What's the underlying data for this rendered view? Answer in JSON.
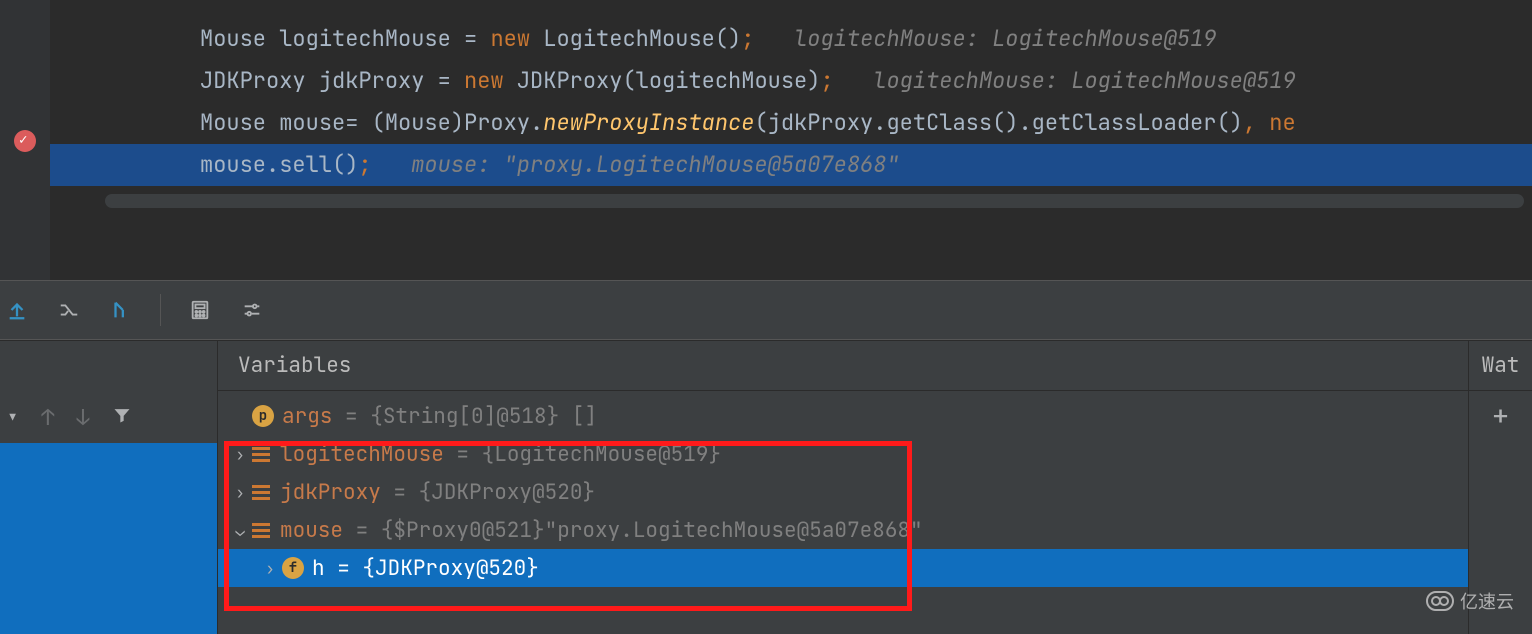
{
  "editor": {
    "lines": [
      {
        "indent": "",
        "type1": "Mouse",
        "id1": "logitechMouse",
        "eq": " = ",
        "kw": "new",
        "call": " LogitechMouse()",
        "semi": ";",
        "hint": "logitechMouse: LogitechMouse@519"
      },
      {
        "indent": "",
        "type1": "JDKProxy",
        "id1": "jdkProxy",
        "eq": " = ",
        "kw": "new",
        "call": " JDKProxy(logitechMouse)",
        "semi": ";",
        "hint": "logitechMouse: LogitechMouse@519"
      },
      {
        "indent": "",
        "type1": "Mouse",
        "id1": "mouse",
        "eq": "= (Mouse)Proxy.",
        "mtd": "newProxyInstance",
        "rest": "(jdkProxy.getClass().getClassLoader()",
        "tail": ", ne"
      },
      {
        "current": true,
        "call": "mouse.sell()",
        "semi": ";",
        "hint": "mouse: \"proxy.LogitechMouse@5a07e868\""
      }
    ]
  },
  "toolbar": {
    "icons": [
      "upload-icon",
      "shuffle-icon",
      "goto-icon",
      "sep",
      "calculator-icon",
      "settings-icon"
    ]
  },
  "debug": {
    "variables_label": "Variables",
    "watches_label": "Wat",
    "vars": [
      {
        "badge": "p",
        "name": "args",
        "val": "{String[0]@518} []",
        "arrow": ""
      },
      {
        "obj": true,
        "name": "logitechMouse",
        "val": "{LogitechMouse@519}",
        "arrow": "›"
      },
      {
        "obj": true,
        "name": "jdkProxy",
        "val": "{JDKProxy@520}",
        "arrow": "›"
      },
      {
        "obj": true,
        "name": "mouse",
        "val": "{$Proxy0@521}",
        "str": "\"proxy.LogitechMouse@5a07e868\"",
        "arrow": "⌄"
      },
      {
        "badge": "f",
        "name": "h",
        "val": "{JDKProxy@520}",
        "arrow": "›",
        "indent": 1,
        "selected": true
      }
    ]
  },
  "watermark": "亿速云"
}
